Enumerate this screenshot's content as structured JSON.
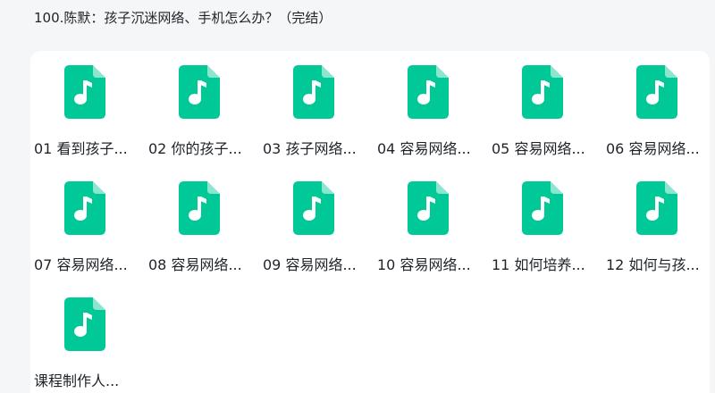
{
  "folder": {
    "title": "100.陈默：孩子沉迷网络、手机怎么办？（完结）"
  },
  "icon": {
    "name": "audio-file-icon",
    "color": "#00c896",
    "glyph_color": "#ffffff"
  },
  "files": [
    {
      "name": "01 看到孩子..."
    },
    {
      "name": "02 你的孩子..."
    },
    {
      "name": "03 孩子网络..."
    },
    {
      "name": "04 容易网络..."
    },
    {
      "name": "05 容易网络..."
    },
    {
      "name": "06 容易网络..."
    },
    {
      "name": "07 容易网络..."
    },
    {
      "name": "08 容易网络..."
    },
    {
      "name": "09 容易网络..."
    },
    {
      "name": "10 容易网络..."
    },
    {
      "name": "11 如何培养..."
    },
    {
      "name": "12 如何与孩..."
    },
    {
      "name": "课程制作人..."
    }
  ]
}
